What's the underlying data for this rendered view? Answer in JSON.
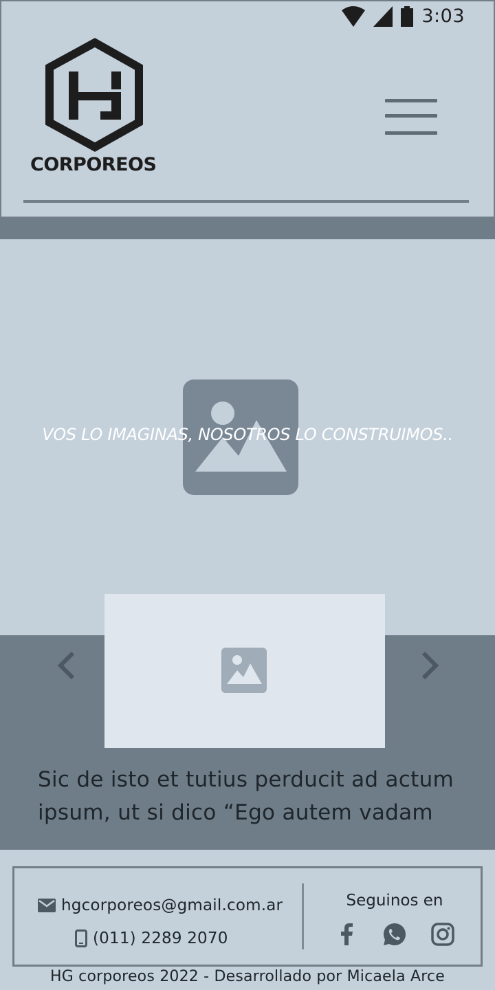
{
  "status_bar": {
    "time": "3:03",
    "icons": [
      "wifi-icon",
      "cellular-signal-icon",
      "battery-icon"
    ]
  },
  "header": {
    "logo_text": "CORPOREOS",
    "menu_icon": "hamburger-menu-icon"
  },
  "hero": {
    "tagline": "VOS LO IMAGINAS, NOSOTROS LO CONSTRUIMOS..",
    "image_icon": "image-placeholder-icon"
  },
  "slider": {
    "prev_icon": "chevron-left-icon",
    "next_icon": "chevron-right-icon",
    "image_icon": "image-placeholder-icon",
    "text": "Sic de isto et tutius perducit ad actum ipsum, ut si dico “Ego autem vadam"
  },
  "footer": {
    "email": "hgcorporeos@gmail.com.ar",
    "phone": "(011) 2289 2070",
    "social_title": "Seguinos en",
    "social_icons": [
      "facebook-icon",
      "whatsapp-icon",
      "instagram-icon"
    ],
    "copyright": "HG corporeos 2022 - Desarrollado por Micaela Arce"
  },
  "colors": {
    "background": "#c4d0da",
    "band": "#6f7d88",
    "border": "#727f89",
    "placeholder": "#7a8896",
    "card": "#dfe6ee"
  }
}
